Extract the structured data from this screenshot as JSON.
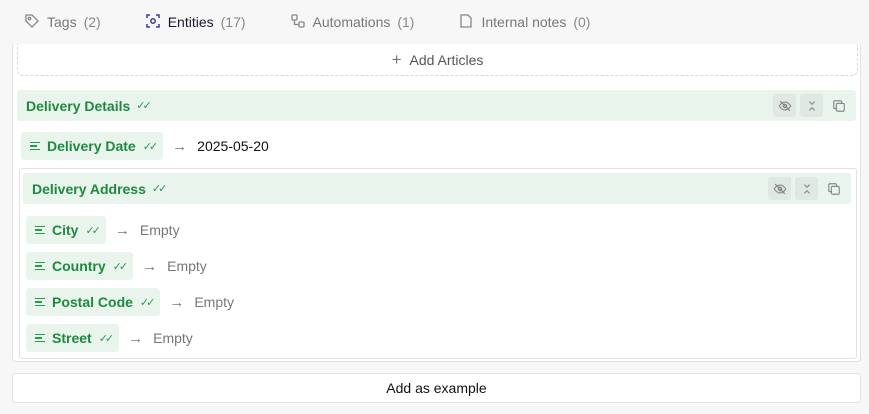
{
  "tabs": [
    {
      "label": "Tags",
      "count": "(2)",
      "icon": "tag-icon",
      "active": false
    },
    {
      "label": "Entities",
      "count": "(17)",
      "icon": "entity-scan-icon",
      "active": true
    },
    {
      "label": "Automations",
      "count": "(1)",
      "icon": "automation-icon",
      "active": false
    },
    {
      "label": "Internal notes",
      "count": "(0)",
      "icon": "note-icon",
      "active": false
    }
  ],
  "add_articles_label": "Add Articles",
  "delivery_details": {
    "title": "Delivery Details",
    "delivery_date": {
      "label": "Delivery Date",
      "value": "2025-05-20"
    }
  },
  "delivery_address": {
    "title": "Delivery Address",
    "fields": [
      {
        "label": "City",
        "value": "Empty"
      },
      {
        "label": "Country",
        "value": "Empty"
      },
      {
        "label": "Postal Code",
        "value": "Empty"
      },
      {
        "label": "Street",
        "value": "Empty"
      }
    ]
  },
  "add_example_label": "Add as example",
  "colors": {
    "accent_green": "#1f8a3f",
    "chip_bg": "#e8f4ec"
  }
}
